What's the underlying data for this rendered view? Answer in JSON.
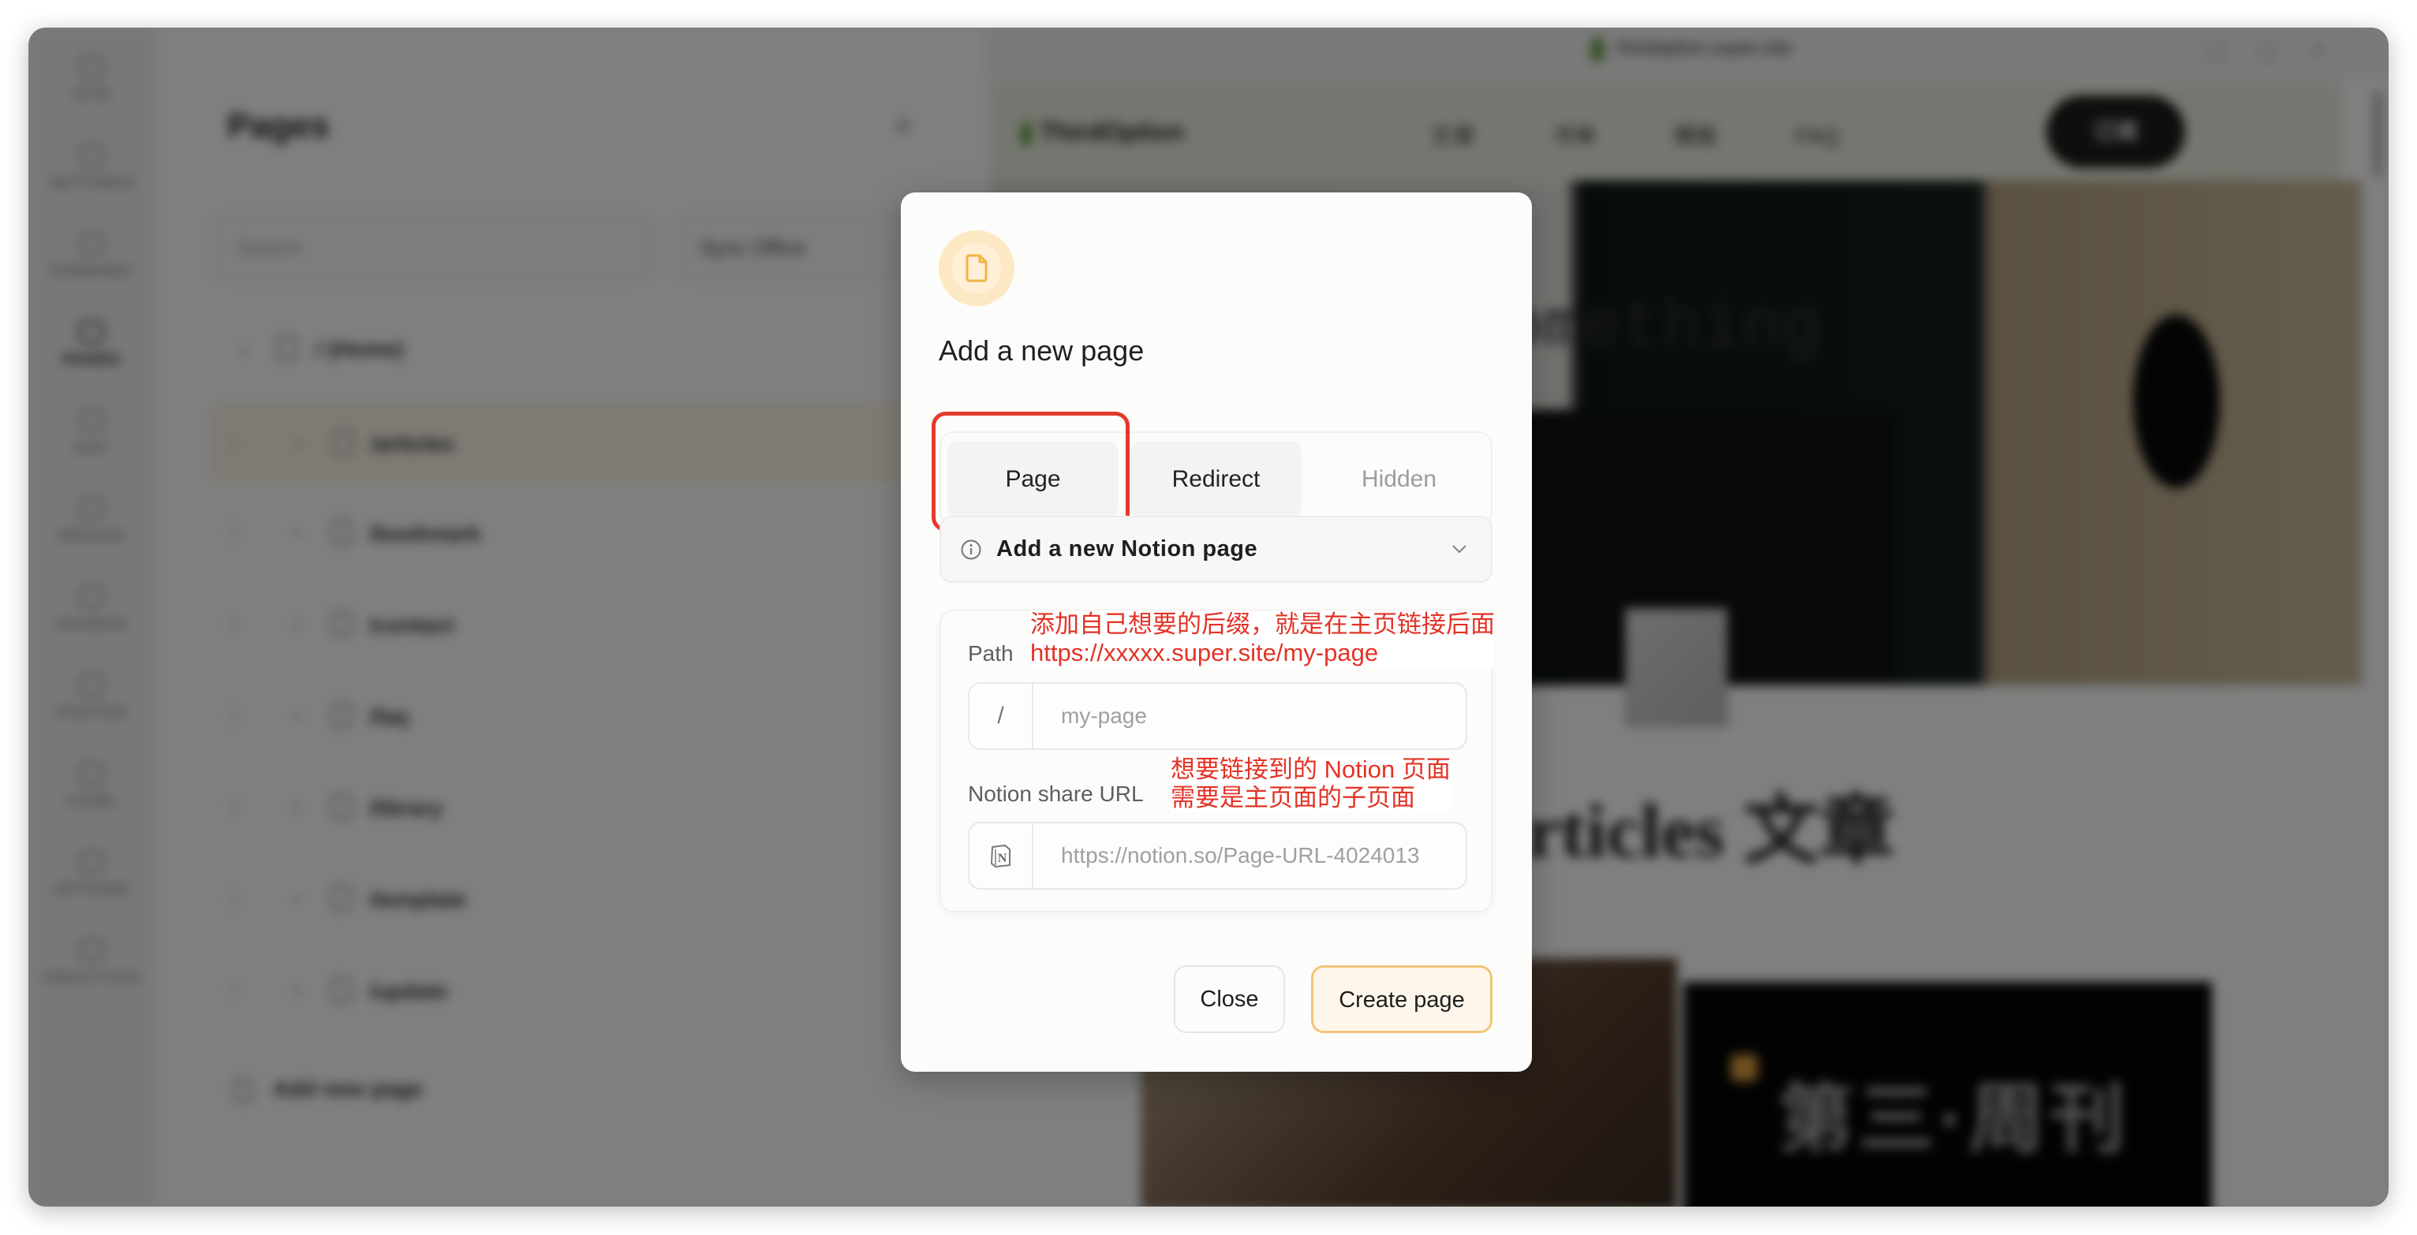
{
  "sidebar": {
    "items": [
      {
        "label": "SITE",
        "icon": "globe-icon"
      },
      {
        "label": "SETTINGS",
        "icon": "gear-icon"
      },
      {
        "label": "DOMAINS",
        "icon": "domain-icon"
      },
      {
        "label": "PAGES",
        "icon": "page-icon",
        "active": true
      },
      {
        "label": "NAV",
        "icon": "nav-icon"
      },
      {
        "label": "DESIGN",
        "icon": "palette-icon"
      },
      {
        "label": "NAVBAR",
        "icon": "navbar-icon"
      },
      {
        "label": "FOOTER",
        "icon": "footer-icon"
      },
      {
        "label": "CODE",
        "icon": "code-icon"
      },
      {
        "label": "OPTIONS",
        "icon": "options-icon"
      },
      {
        "label": "ANALYTICS",
        "icon": "analytics-icon"
      }
    ]
  },
  "pages_panel": {
    "title": "Pages",
    "add_icon": "+",
    "search_placeholder": "Search",
    "filter_label": "Sync Office",
    "rows": [
      {
        "name": "/ (Home)"
      },
      {
        "name": "/articles"
      },
      {
        "name": "/bookmark"
      },
      {
        "name": "/contact"
      },
      {
        "name": "/faq"
      },
      {
        "name": "/library"
      },
      {
        "name": "/template"
      },
      {
        "name": "/update"
      }
    ],
    "add_new_page": "Add new page"
  },
  "preview": {
    "url": "thirdoption.super.site",
    "brand": "ThirdOption",
    "nav_links": [
      "文章",
      "书单",
      "模板",
      "FAQ"
    ],
    "nav_cta": "订阅",
    "hero_text": "e something",
    "section_title": "Articles 文章",
    "card_text": "第三·周刊"
  },
  "modal": {
    "icon": "file-icon",
    "title": "Add a new page",
    "tabs": [
      {
        "label": "Page",
        "selected": true
      },
      {
        "label": "Redirect",
        "selected": false
      },
      {
        "label": "Hidden",
        "selected": false
      }
    ],
    "notion_select": {
      "label": "Add a new Notion page",
      "icon": "info-icon"
    },
    "path": {
      "label": "Path",
      "prefix": "/",
      "placeholder": "my-page",
      "value": ""
    },
    "notion_url": {
      "label": "Notion share URL",
      "prefix_icon": "notion-icon",
      "placeholder": "https://notion.so/Page-URL-4024013",
      "value": ""
    },
    "buttons": {
      "close": "Close",
      "create": "Create page"
    }
  },
  "annotations": {
    "path_note_line1": "添加自己想要的后缀，就是在主页链接后面",
    "path_note_line2": "https://xxxxx.super.site/my-page",
    "url_note_line1": "想要链接到的 Notion 页面",
    "url_note_line2": "需要是主页面的子页面",
    "highlight_color": "#e23a2c"
  },
  "colors": {
    "accent": "#f2b545",
    "accent_bg": "#fef6eb",
    "annotation": "#e23326"
  }
}
